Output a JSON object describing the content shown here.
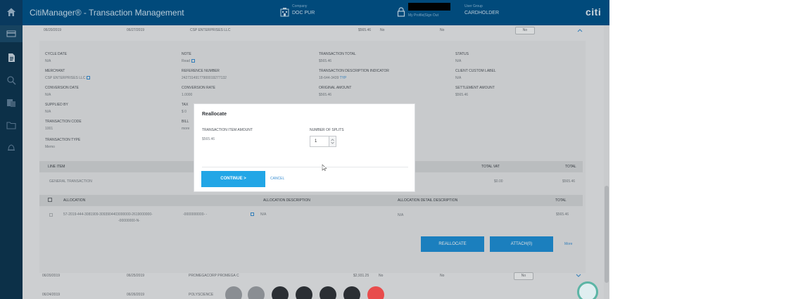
{
  "header": {
    "app_title": "CitiManager® - Transaction Management",
    "company_label": "Company",
    "company_value": "DOC PUR",
    "user_link": "My Profile|Sign Out",
    "user_group_label": "User Group",
    "user_group_value": "CARDHOLDER",
    "brand": "citi"
  },
  "sidebar": {
    "icons": [
      "home-icon",
      "card-icon",
      "document-icon",
      "search-icon",
      "reports-icon",
      "folder-icon",
      "notification-icon"
    ]
  },
  "transactions": {
    "top_row": {
      "date1": "06/20/2019",
      "date2": "06/27/2019",
      "merchant": "CSP ENTERPRISES LLC",
      "amount": "$565.46",
      "flag": "No",
      "flag2": "No",
      "pill": "No"
    },
    "details": {
      "cycle_date_label": "CYCLE DATE",
      "cycle_date_value": "N/A",
      "note_label": "NOTE",
      "note_value": "Read",
      "transaction_total_label": "TRANSACTION TOTAL",
      "transaction_total_value": "$565.46",
      "status_label": "STATUS",
      "status_value": "N/A",
      "merchant_label": "MERCHANT",
      "merchant_value": "CSP ENTERPRISES LLC",
      "reference_number_label": "REFERENCE NUMBER",
      "reference_number_value": "24273149177900019277132",
      "tdi_label": "TRANSACTION DESCRIPTION INDICATOR",
      "tdi_value": "18-644-3439",
      "tdi_link": "TYP",
      "client_label_label": "CLIENT CUSTOM LABEL",
      "client_label_value": "N/A",
      "conversion_date_label": "CONVERSION DATE",
      "conversion_date_value": "N/A",
      "conversion_rate_label": "CONVERSION RATE",
      "conversion_rate_value": "1.0000",
      "original_amount_label": "ORIGINAL AMOUNT",
      "original_amount_value": "$565.46",
      "settlement_label": "SETTLEMENT AMOUNT",
      "settlement_value": "$565.46",
      "supplied_by_label": "SUPPLIED BY",
      "supplied_by_value": "N/A",
      "tax_label": "TAX",
      "tax_value": "$ 0",
      "transaction_code_label": "TRANSACTION CODE",
      "transaction_code_value": "1001",
      "bill_label": "BILL",
      "bill_value": "more",
      "transaction_type_label": "TRANSACTION TYPE",
      "transaction_type_value": "Memo"
    },
    "line_item_header": {
      "col1": "LINE ITEM",
      "col2": "TOTAL VAT",
      "col3": "TOTAL"
    },
    "line_item_row": {
      "desc": "GENERAL TRANSACTION",
      "vat": "$0.00",
      "total": "$565.46"
    },
    "allocation_header": {
      "col1": "ALLOCATION",
      "col2": "ALLOCATION DESCRIPTION",
      "col3": "ALLOCATION DETAIL DESCRIPTION",
      "col4": "TOTAL"
    },
    "allocation_row": {
      "code1": "57-2019-444-3081909-3093904403000000-2619000000-",
      "code2": "-00000000-N-",
      "code3": "-0000000000- -",
      "desc": "N/A",
      "detail": "N/A",
      "total": "$565.46"
    },
    "reallocate_button": "REALLOCATE",
    "attach_button": "ATTACH(0)",
    "more_link": "More",
    "row2": {
      "date1": "06/20/2019",
      "date2": "06/25/2019",
      "merchant": "PROMEGACORP PROMEGA C",
      "amount": "$2,931.25",
      "flag": "No",
      "flag2": "No",
      "pill": "No"
    },
    "row3": {
      "date1": "06/24/2019",
      "date2": "06/26/2019",
      "merchant": "POLYSCIENCE"
    }
  },
  "modal": {
    "title": "Reallocate",
    "item_amount_label": "TRANSACTION ITEM AMOUNT",
    "item_amount_value": "$565.46",
    "splits_label": "NUMBER OF SPLITS",
    "splits_value": "1",
    "continue_label": "CONTINUE >",
    "cancel_label": "CANCEL"
  },
  "call_controls": {
    "colors": [
      "#8a8e93",
      "#8a8e93",
      "#2b2f34",
      "#2b2f34",
      "#2b2f34",
      "#2b2f34",
      "#e84c4c"
    ]
  }
}
